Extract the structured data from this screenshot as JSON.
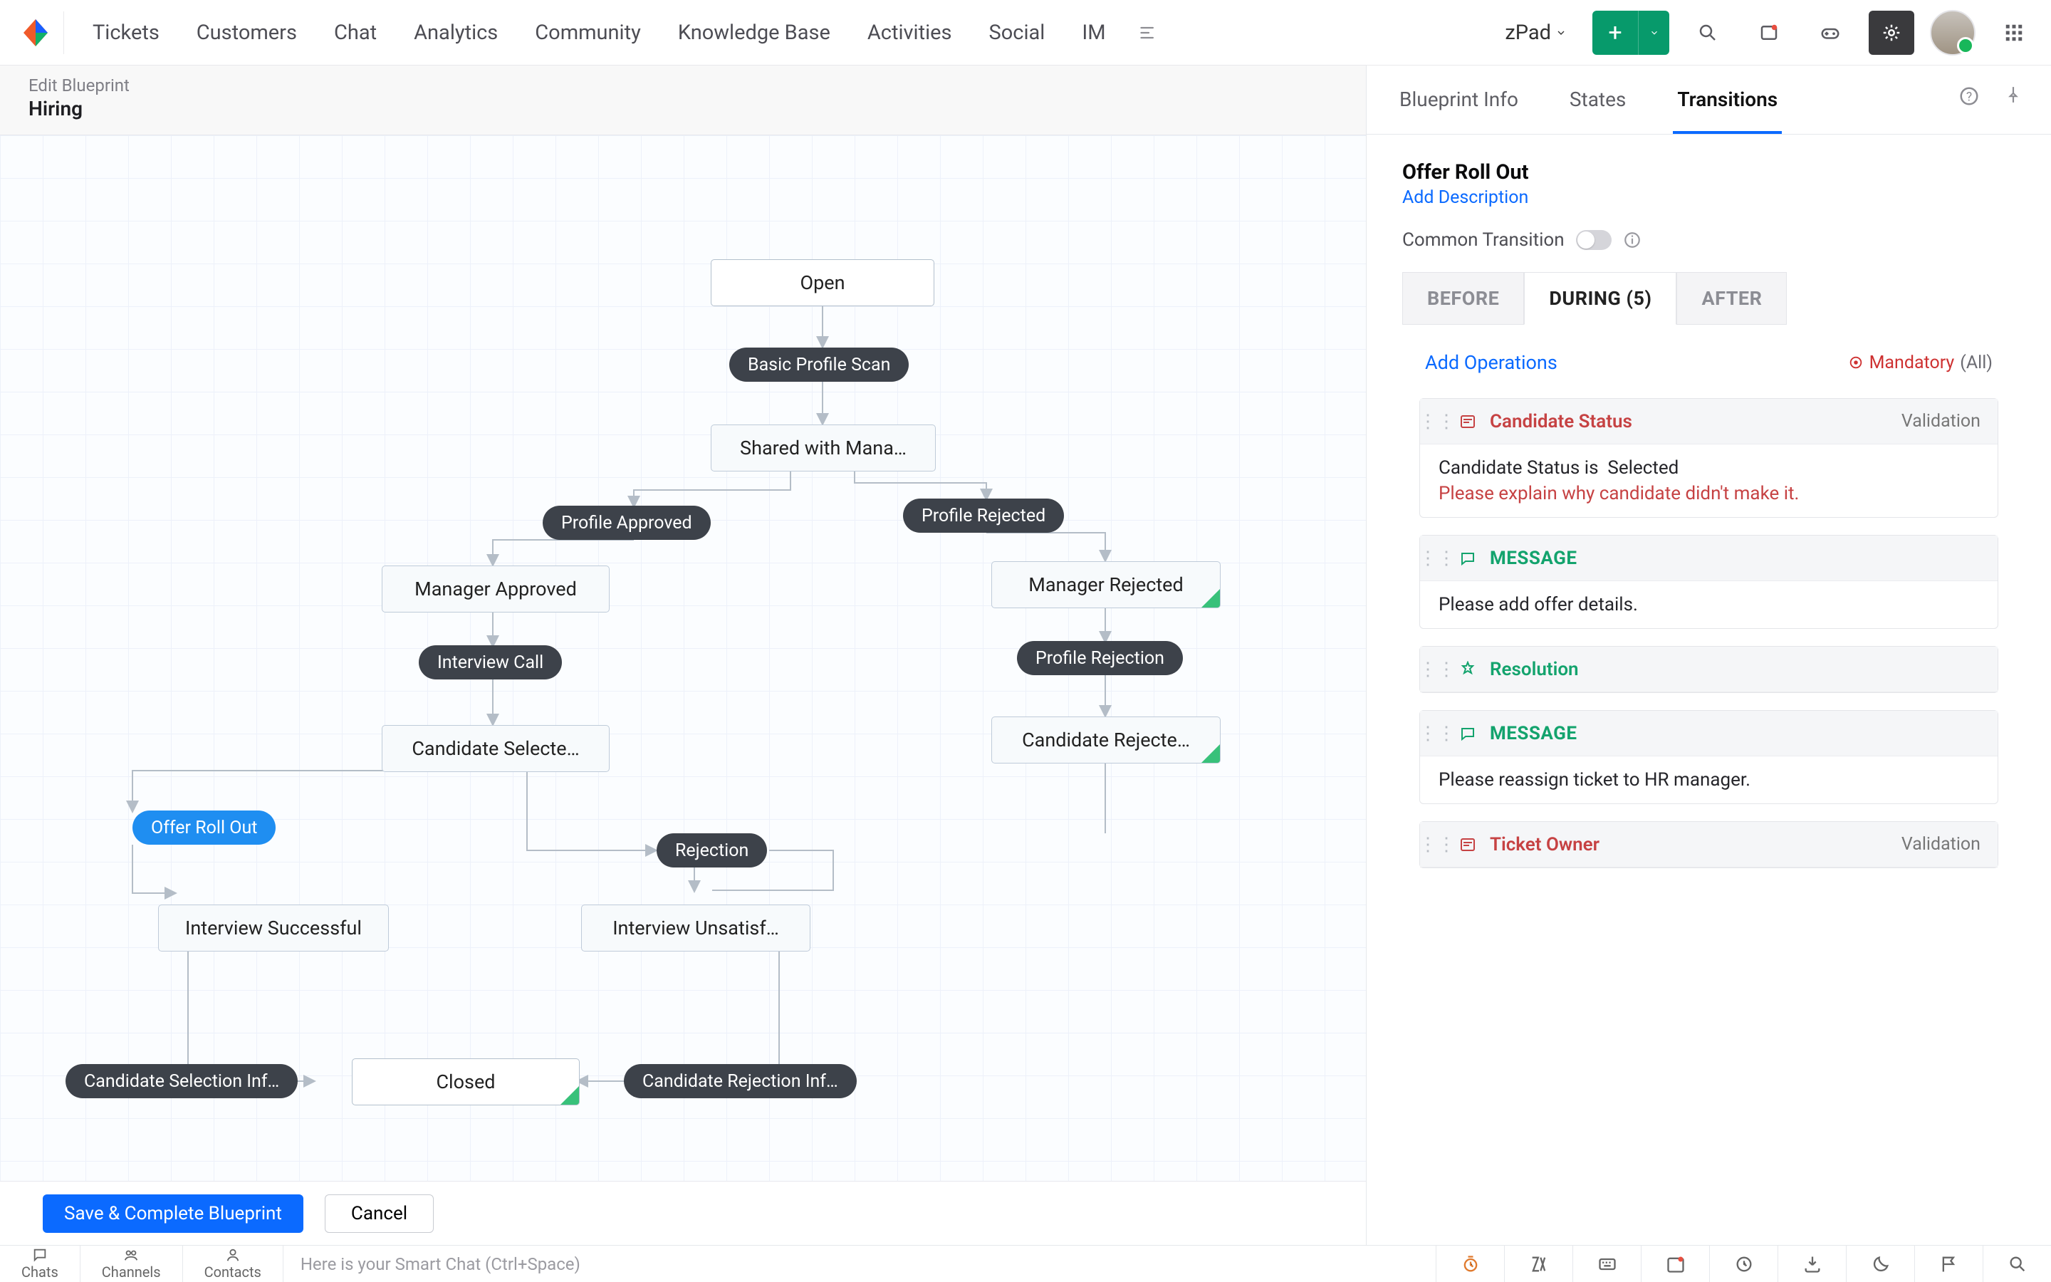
{
  "nav": {
    "items": [
      "Tickets",
      "Customers",
      "Chat",
      "Analytics",
      "Community",
      "Knowledge Base",
      "Activities",
      "Social",
      "IM"
    ],
    "org": "zPad"
  },
  "crumb": {
    "sup": "Edit Blueprint",
    "title": "Hiring"
  },
  "nodes": {
    "open": "Open",
    "sharedMgr": "Shared with Mana…",
    "mgrApproved": "Manager Approved",
    "mgrRejected": "Manager Rejected",
    "candSelected": "Candidate Selecte…",
    "candRejected": "Candidate Rejecte…",
    "intSuccess": "Interview Successful",
    "intUnsat": "Interview Unsatisf…",
    "closed": "Closed"
  },
  "pills": {
    "basic": "Basic Profile Scan",
    "approved": "Profile Approved",
    "rejected": "Profile Rejected",
    "intCall": "Interview Call",
    "profRejection": "Profile Rejection",
    "offer": "Offer Roll Out",
    "rej": "Rejection",
    "candSelInfo": "Candidate Selection Inf…",
    "candRejInfo": "Candidate Rejection Inf…"
  },
  "buttons": {
    "save": "Save & Complete Blueprint",
    "cancel": "Cancel"
  },
  "rp": {
    "tabs": [
      "Blueprint Info",
      "States",
      "Transitions"
    ],
    "activeTab": 2,
    "title": "Offer Roll Out",
    "addDesc": "Add Description",
    "commonTransition": "Common Transition",
    "phases": {
      "before": "BEFORE",
      "during": "DURING (5)",
      "after": "AFTER",
      "active": 1
    },
    "addOps": "Add Operations",
    "mandatory": "Mandatory",
    "mandatoryAll": "(All)",
    "ops": [
      {
        "type": "field",
        "name": "Candidate Status",
        "validation": "Validation",
        "line": "Candidate Status is",
        "val": "Selected",
        "warn": "Please explain why candidate didn't make it."
      },
      {
        "type": "msg",
        "name": "MESSAGE",
        "body": "Please add offer details."
      },
      {
        "type": "res",
        "name": "Resolution"
      },
      {
        "type": "msg",
        "name": "MESSAGE",
        "body": "Please reassign ticket to HR manager."
      },
      {
        "type": "field",
        "name": "Ticket Owner",
        "validation": "Validation"
      }
    ]
  },
  "chatbar": {
    "segs": [
      "Chats",
      "Channels",
      "Contacts"
    ],
    "placeholder": "Here is your Smart Chat (Ctrl+Space)"
  }
}
